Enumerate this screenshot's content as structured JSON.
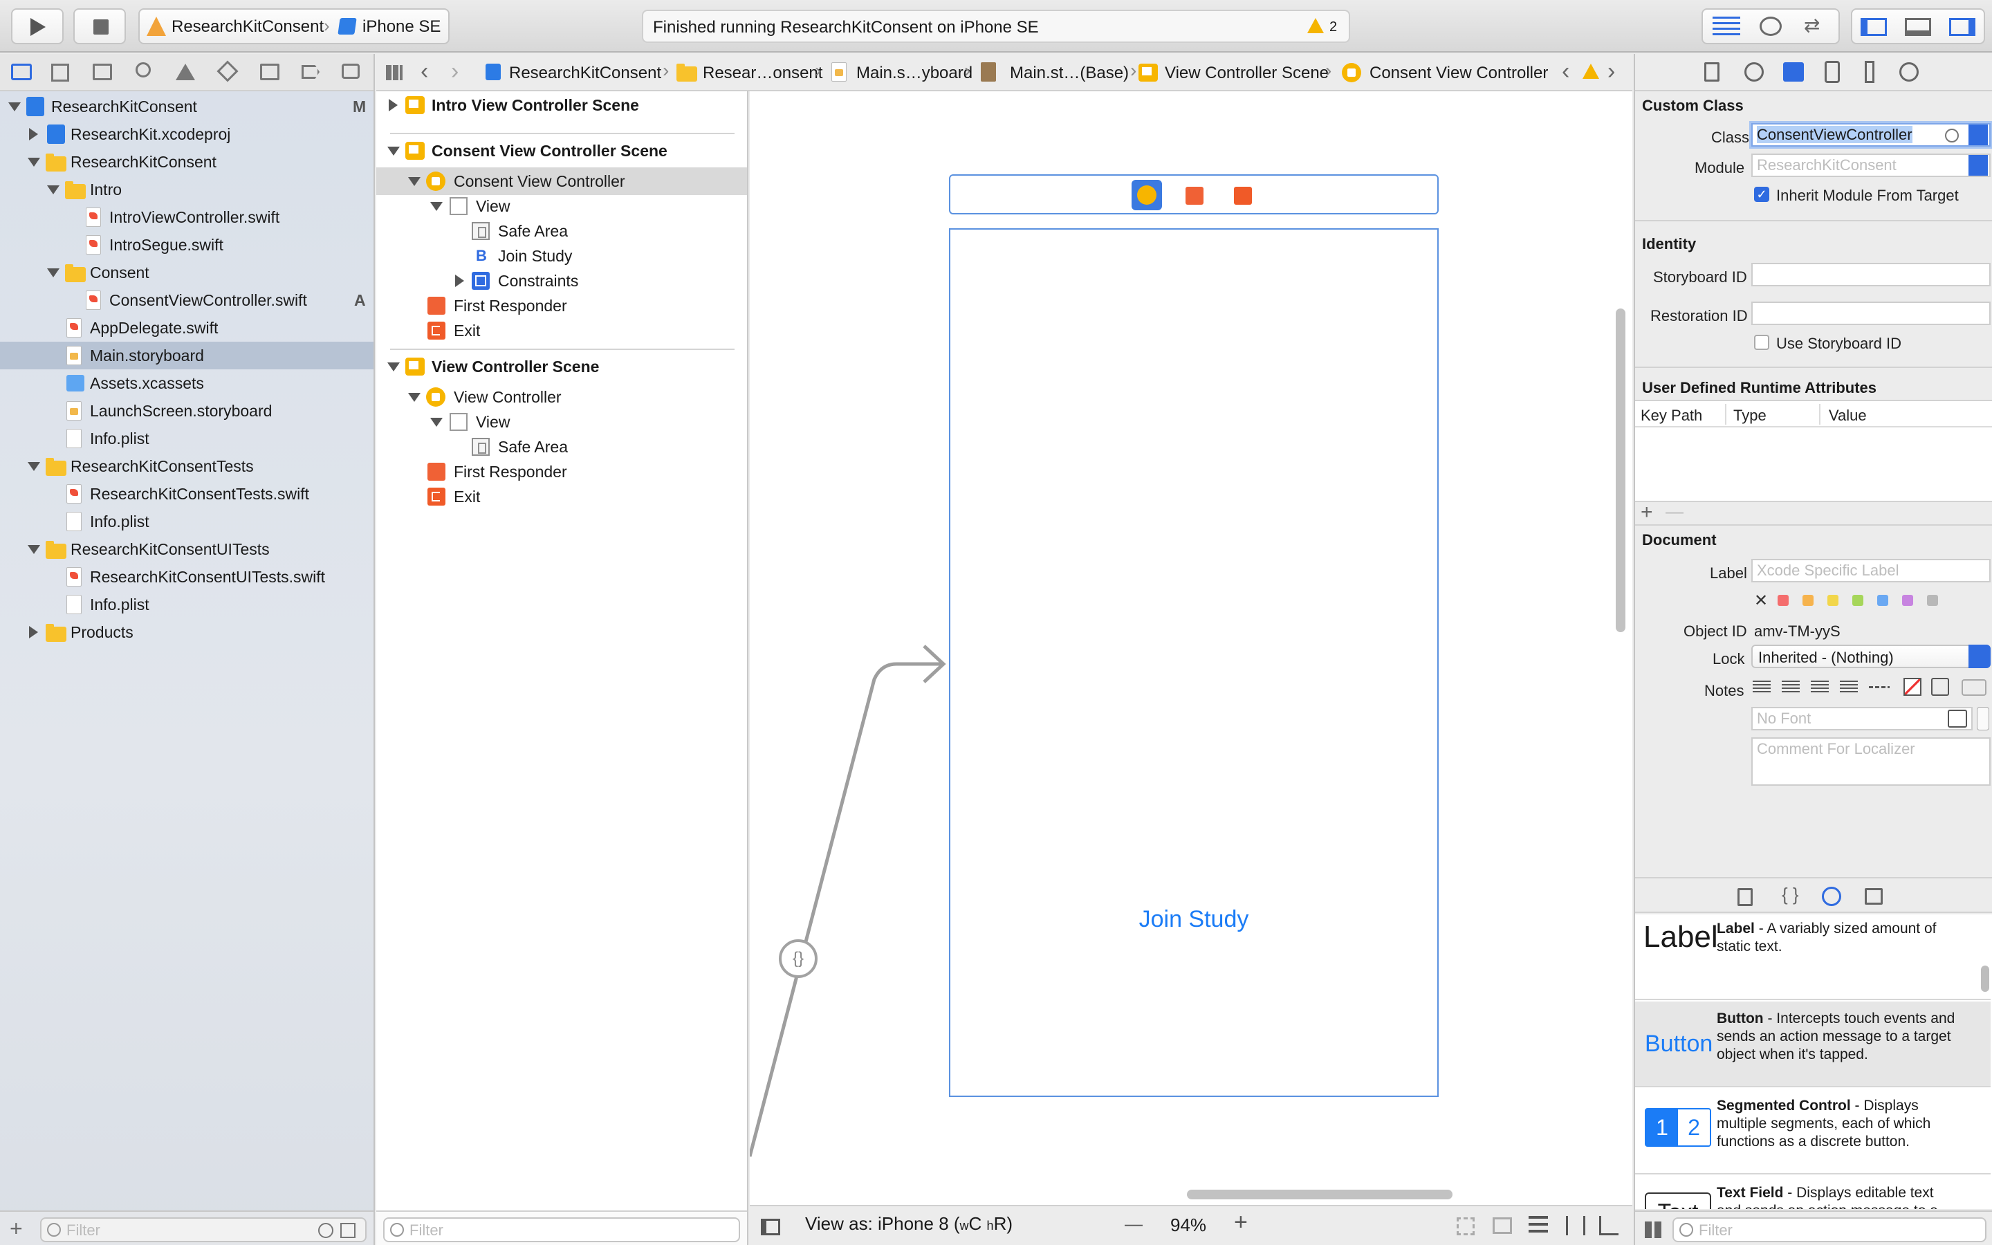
{
  "toolbar": {
    "scheme": "ResearchKitConsent",
    "device": "iPhone SE",
    "status": "Finished running ResearchKitConsent on iPhone SE",
    "warnings": "2"
  },
  "jumpbar": {
    "items": [
      "ResearchKitConsent",
      "Resear…onsent",
      "Main.s…yboard",
      "Main.st…(Base)",
      "View Controller Scene",
      "Consent View Controller"
    ]
  },
  "navigator": {
    "items": [
      {
        "label": "ResearchKitConsent",
        "badge": "M"
      },
      {
        "label": "ResearchKit.xcodeproj"
      },
      {
        "label": "ResearchKitConsent"
      },
      {
        "label": "Intro"
      },
      {
        "label": "IntroViewController.swift"
      },
      {
        "label": "IntroSegue.swift"
      },
      {
        "label": "Consent"
      },
      {
        "label": "ConsentViewController.swift",
        "badge": "A"
      },
      {
        "label": "AppDelegate.swift"
      },
      {
        "label": "Main.storyboard"
      },
      {
        "label": "Assets.xcassets"
      },
      {
        "label": "LaunchScreen.storyboard"
      },
      {
        "label": "Info.plist"
      },
      {
        "label": "ResearchKitConsentTests"
      },
      {
        "label": "ResearchKitConsentTests.swift"
      },
      {
        "label": "Info.plist"
      },
      {
        "label": "ResearchKitConsentUITests"
      },
      {
        "label": "ResearchKitConsentUITests.swift"
      },
      {
        "label": "Info.plist"
      },
      {
        "label": "Products"
      }
    ],
    "filter_placeholder": "Filter"
  },
  "outline": {
    "items": [
      {
        "label": "Intro View Controller Scene"
      },
      {
        "label": "Consent View Controller Scene"
      },
      {
        "label": "Consent View Controller"
      },
      {
        "label": "View"
      },
      {
        "label": "Safe Area"
      },
      {
        "label": "Join Study"
      },
      {
        "label": "Constraints"
      },
      {
        "label": "First Responder"
      },
      {
        "label": "Exit"
      },
      {
        "label": "View Controller Scene"
      },
      {
        "label": "View Controller"
      },
      {
        "label": "View"
      },
      {
        "label": "Safe Area"
      },
      {
        "label": "First Responder"
      },
      {
        "label": "Exit"
      }
    ],
    "filter_placeholder": "Filter",
    "join_study_glyph": "B"
  },
  "canvas": {
    "button_label": "Join Study",
    "segue_glyph": "{}",
    "view_as": "View as: iPhone 8 (",
    "size_w": "w",
    "size_c": "C ",
    "size_h": "h",
    "size_r": "R)",
    "zoom": "94%",
    "zoom_out": "—",
    "zoom_in": "+"
  },
  "inspector": {
    "custom_class_title": "Custom Class",
    "class_label": "Class",
    "class_value": "ConsentViewController",
    "module_label": "Module",
    "module_placeholder": "ResearchKitConsent",
    "inherit_label": "Inherit Module From Target",
    "identity_title": "Identity",
    "storyboard_id_label": "Storyboard ID",
    "restoration_id_label": "Restoration ID",
    "use_storyboard_id_label": "Use Storyboard ID",
    "runtime_attr_title": "User Defined Runtime Attributes",
    "col_key_path": "Key Path",
    "col_type": "Type",
    "col_value": "Value",
    "document_title": "Document",
    "label_label": "Label",
    "label_placeholder": "Xcode Specific Label",
    "object_id_label": "Object ID",
    "object_id_value": "amv-TM-yyS",
    "lock_label": "Lock",
    "lock_value": "Inherited - (Nothing)",
    "notes_label": "Notes",
    "font_placeholder": "No Font",
    "comment_placeholder": "Comment For Localizer",
    "label_colors": [
      "#f46d6d",
      "#f6b34d",
      "#f2d64a",
      "#a6d65a",
      "#6aa8f2",
      "#c784e0",
      "#b8b8b8"
    ]
  },
  "library": {
    "items": [
      {
        "preview": "Label",
        "title": "Label",
        "desc1": " - A variably sized amount of",
        "desc2": "static text."
      },
      {
        "preview": "Button",
        "title": "Button",
        "desc1": " - Intercepts touch events and",
        "desc2": "sends an action message to a target",
        "desc3": "object when it's tapped."
      },
      {
        "preview_a": "1",
        "preview_b": "2",
        "title": "Segmented Control",
        "desc1": " - Displays",
        "desc2": "multiple segments, each of which",
        "desc3": "functions as a discrete button."
      },
      {
        "preview": "Text",
        "title": "Text Field",
        "desc1": " - Displays editable text",
        "desc2": "and sends an action message to a"
      }
    ],
    "filter_placeholder": "Filter"
  },
  "colors": {
    "accent": "#2f6be0",
    "selection": "#b9c7dc",
    "ios_blue": "#1b7cf6"
  }
}
